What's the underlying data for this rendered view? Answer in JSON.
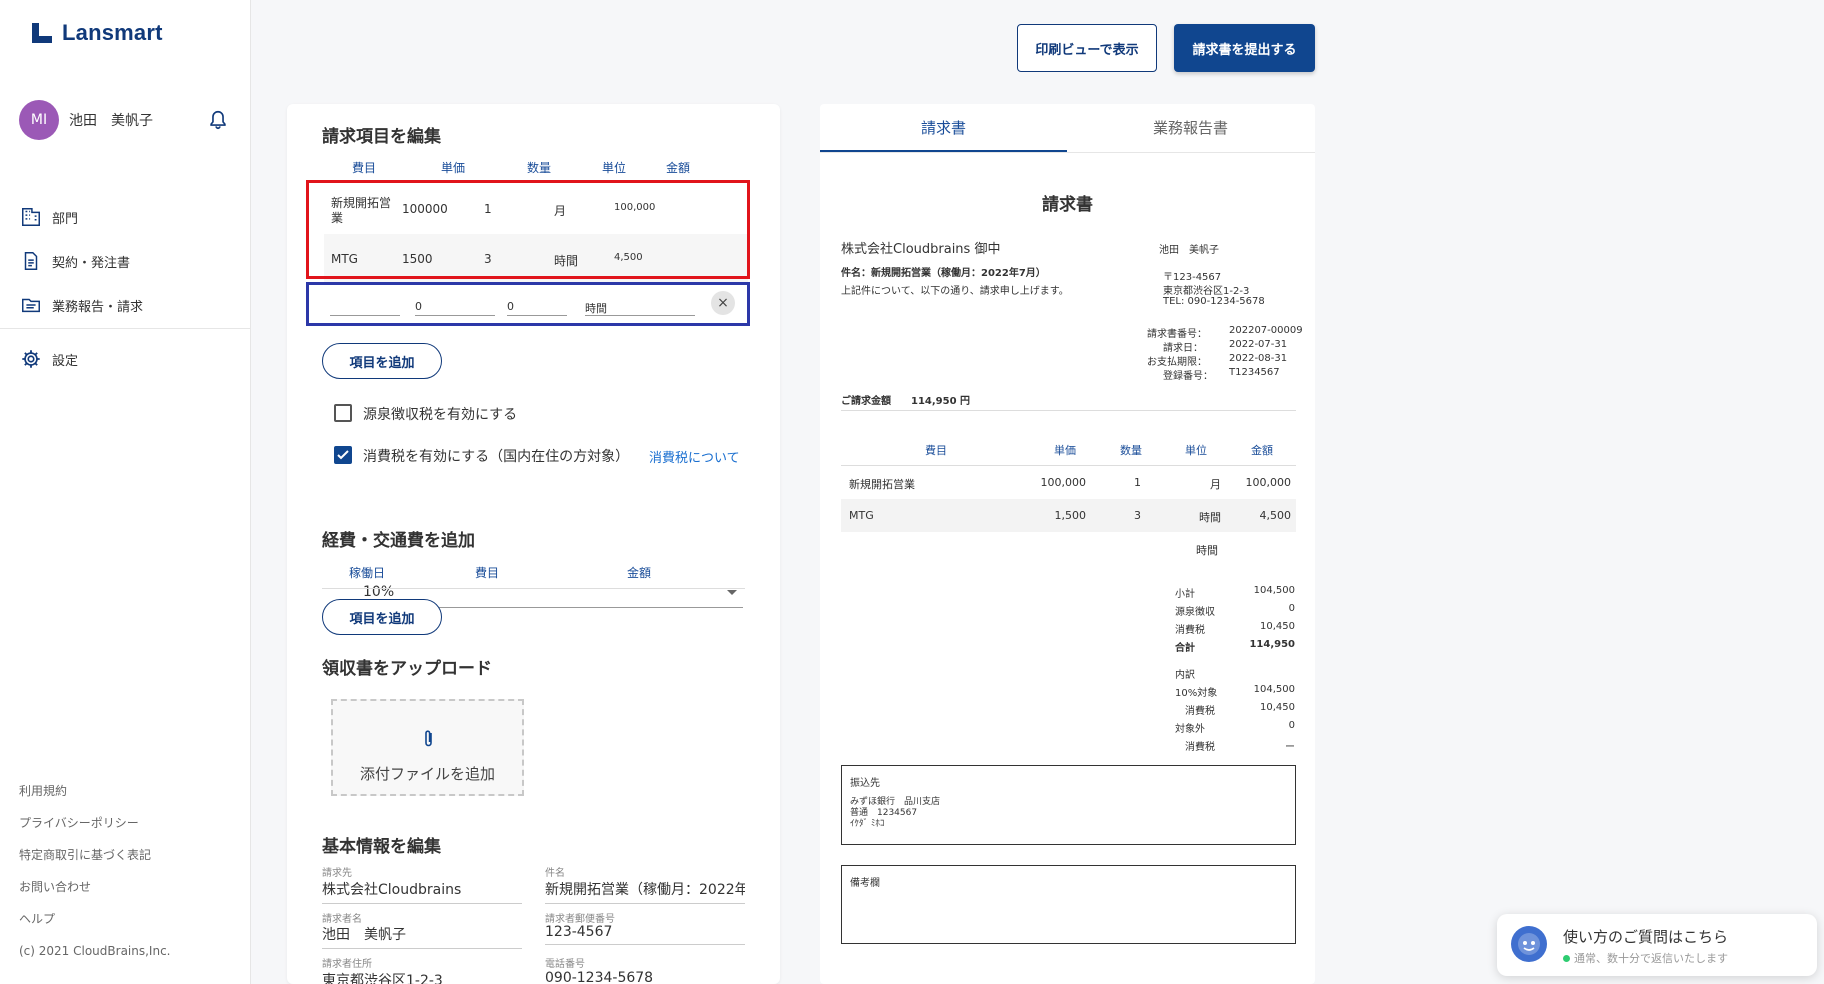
{
  "app": {
    "name": "Lansmart"
  },
  "user": {
    "initials": "MI",
    "name": "池田　美帆子"
  },
  "nav": {
    "items": [
      {
        "label": "部門"
      },
      {
        "label": "契約・発注書"
      },
      {
        "label": "業務報告・請求"
      }
    ],
    "settings": "設定"
  },
  "footer": {
    "links": [
      "利用規約",
      "プライバシーポリシー",
      "特定商取引に基づく表記",
      "お問い合わせ",
      "ヘルプ"
    ],
    "copyright": "(c) 2021 CloudBrains,Inc."
  },
  "toolbar": {
    "print_view": "印刷ビューで表示",
    "submit": "請求書を提出する"
  },
  "edit": {
    "items_title": "請求項目を編集",
    "columns": [
      "費目",
      "単価",
      "数量",
      "単位",
      "金額"
    ],
    "rows": [
      {
        "name": "新規開拓営業",
        "price": "100000",
        "qty": "1",
        "unit": "月",
        "amount": "100,000"
      },
      {
        "name": "MTG",
        "price": "1500",
        "qty": "3",
        "unit": "時間",
        "amount": "4,500"
      }
    ],
    "new_row": {
      "name": "",
      "price": "0",
      "qty": "0",
      "unit": "時間",
      "amount": ""
    },
    "clear_symbol": "×",
    "add_item": "項目を追加",
    "withholding_label": "源泉徴収税を有効にする",
    "withholding_checked": false,
    "tax_label": "消費税を有効にする（国内在住の方対象）",
    "tax_checked": true,
    "tax_link": "消費税について",
    "tax_rate": "10%",
    "expenses_title": "経費・交通費を追加",
    "expense_columns": [
      "稼働日",
      "費目",
      "金額"
    ],
    "add_expense": "項目を追加",
    "receipt_title": "領収書をアップロード",
    "attach_label": "添付ファイルを追加",
    "basic_title": "基本情報を編集",
    "fields": {
      "billto_label": "請求先",
      "billto_value": "株式会社Cloudbrains",
      "subject_label": "件名",
      "subject_value": "新規開拓営業（稼働月：2022年",
      "biller_label": "請求者名",
      "biller_value": "池田　美帆子",
      "zip_label": "請求者郵便番号",
      "zip_value": "123-4567",
      "address_label": "請求者住所",
      "address_value": "東京都渋谷区1-2-3",
      "phone_label": "電話番号",
      "phone_value": "090-1234-5678"
    }
  },
  "preview": {
    "tabs": [
      "請求書",
      "業務報告書"
    ],
    "title": "請求書",
    "recipient": "株式会社Cloudbrains 御中",
    "subject": "件名：新規開拓営業（稼働月：2022年7月）",
    "intro": "上記件について、以下の通り、請求申し上げます。",
    "issuer_name": "池田　美帆子",
    "zip": "〒123-4567",
    "address": "東京都渋谷区1-2-3",
    "tel": "TEL: 090-1234-5678",
    "meta": [
      {
        "label": "請求書番号：",
        "value": "202207-00009"
      },
      {
        "label": "請求日：",
        "value": "2022-07-31"
      },
      {
        "label": "お支払期限：",
        "value": "2022-08-31"
      },
      {
        "label": "登録番号：",
        "value": "T1234567"
      }
    ],
    "total_label": "ご請求金額",
    "total_value": "114,950 円",
    "columns": [
      "費目",
      "単価",
      "数量",
      "単位",
      "金額"
    ],
    "rows": [
      {
        "name": "新規開拓営業",
        "price": "100,000",
        "qty": "1",
        "unit": "月",
        "amount": "100,000"
      },
      {
        "name": "MTG",
        "price": "1,500",
        "qty": "3",
        "unit": "時間",
        "amount": "4,500"
      }
    ],
    "extra_unit": "時間",
    "summary": [
      {
        "label": "小計",
        "value": "104,500",
        "bold": false
      },
      {
        "label": "源泉徴収",
        "value": "0",
        "bold": false
      },
      {
        "label": "消費税",
        "value": "10,450",
        "bold": false
      },
      {
        "label": "合計",
        "value": "114,950",
        "bold": true
      }
    ],
    "breakdown_title": "内訳",
    "breakdown": [
      {
        "label": "10%対象",
        "value": "104,500"
      },
      {
        "label": "消費税",
        "value": "10,450"
      },
      {
        "label": "対象外",
        "value": "0"
      },
      {
        "label": "消費税",
        "value": "ー"
      }
    ],
    "bank_title": "振込先",
    "bank_lines": [
      "みずほ銀行　品川支店",
      "普通　1234567",
      "ｲｹﾀﾞ ﾐﾎｺ"
    ],
    "notes_title": "備考欄"
  },
  "help": {
    "title": "使い方のご質問はこちら",
    "subtitle": "通常、数十分で返信いたします"
  },
  "colors": {
    "brand": "#10397a",
    "primary": "#10468f",
    "highlight_red": "#e1141b",
    "highlight_blue": "#2c38a8"
  }
}
